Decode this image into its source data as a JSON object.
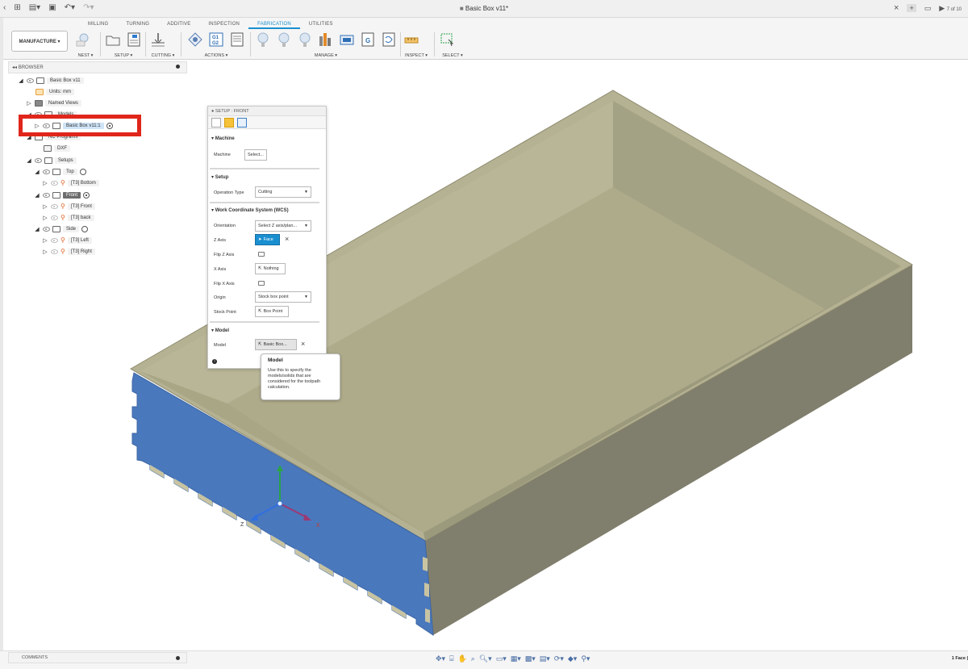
{
  "window": {
    "title": "Basic Box v11*",
    "page_indicator": "7 of 10"
  },
  "ribbon": {
    "workspace": "MANUFACTURE ▾",
    "tabs": [
      "MILLING",
      "TURNING",
      "ADDITIVE",
      "INSPECTION",
      "FABRICATION",
      "UTILITIES"
    ],
    "active_tab": "FABRICATION",
    "groups": [
      "NEST ▾",
      "SETUP ▾",
      "CUTTING ▾",
      "ACTIONS ▾",
      "MANAGE ▾",
      "INSPECT ▾",
      "SELECT ▾"
    ],
    "actions_icon_text": "G1\nG2",
    "manage_icon_labels": [
      "G",
      "G"
    ]
  },
  "browser": {
    "header": "BROWSER",
    "items": [
      {
        "label": "Basic Box v11"
      },
      {
        "label": "Units: mm"
      },
      {
        "label": "Named Views"
      },
      {
        "label": "Models"
      },
      {
        "label": "Basic Box v11:1"
      },
      {
        "label": "NC Programs"
      },
      {
        "label": "DXF"
      },
      {
        "label": "Setups"
      },
      {
        "label": "Top"
      },
      {
        "label": "[T3] Bottom"
      },
      {
        "label": "Front"
      },
      {
        "label": "[T3] Front"
      },
      {
        "label": "[T3] back"
      },
      {
        "label": "Side"
      },
      {
        "label": "[T3] Left"
      },
      {
        "label": "[T3] Right"
      }
    ]
  },
  "dialog": {
    "title": "SETUP : FRONT",
    "sections": {
      "machine": "Machine",
      "setup": "Setup",
      "wcs": "Work Coordinate System (WCS)",
      "model": "Model"
    },
    "fields": {
      "machine_label": "Machine",
      "machine_value": "Select...",
      "op_type_label": "Operation Type",
      "op_type_value": "Cutting",
      "orientation_label": "Orientation",
      "orientation_value": "Select Z axis/plan...",
      "z_axis_label": "Z Axis",
      "z_axis_value": "Face",
      "flip_z_label": "Flip Z Axis",
      "x_axis_label": "X Axis",
      "x_axis_value": "Nothing",
      "flip_x_label": "Flip X Axis",
      "origin_label": "Origin",
      "origin_value": "Stock box point",
      "stock_point_label": "Stock Point",
      "stock_point_value": "Box Point",
      "model_label": "Model",
      "model_value": "Basic Box..."
    }
  },
  "tooltip": {
    "title": "Model",
    "body": "Use this to specify the models/solids that are considered for the toolpath calculation."
  },
  "viewport": {
    "axis_labels": {
      "z": "Z",
      "x": "X"
    },
    "colors": {
      "box_top": "#a7a484",
      "box_inner": "#aeab8b",
      "box_side": "#807e6c",
      "selected_face": "#4a78bd"
    }
  },
  "footer": {
    "comments": "COMMENTS",
    "status": "1 Face |"
  }
}
